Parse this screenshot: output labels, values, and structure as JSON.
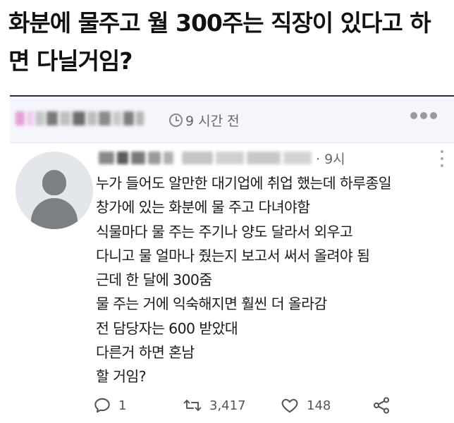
{
  "post": {
    "title": "화분에 물주고 월 300주는 직장이 있다고 하면 다닐거임?"
  },
  "card_header": {
    "time_text": "9 시간 전"
  },
  "tweet": {
    "time_text": "· 9시",
    "lines": [
      "누가 들어도 알만한 대기업에 취업 했는데 하루종일",
      "창가에 있는 화분에 물 주고 다녀야함",
      "식물마다 물 주는 주기나 양도 달라서 외우고",
      "다니고 물 얼마나 줬는지 보고서 써서 올려야 됨",
      "근데 한 달에 300줌",
      "물 주는 거에 익숙해지면 훨씬 더 올라감",
      "전 담당자는 600 받았대",
      "다른거 하면 혼남",
      "할 거임?"
    ],
    "actions": {
      "reply_count": "1",
      "retweet_count": "3,417",
      "like_count": "148"
    }
  },
  "icons": {
    "clock": "clock-icon",
    "more": "more-icon",
    "caret": "more-vertical-icon",
    "reply": "reply-icon",
    "retweet": "retweet-icon",
    "like": "heart-icon",
    "share": "share-icon"
  }
}
